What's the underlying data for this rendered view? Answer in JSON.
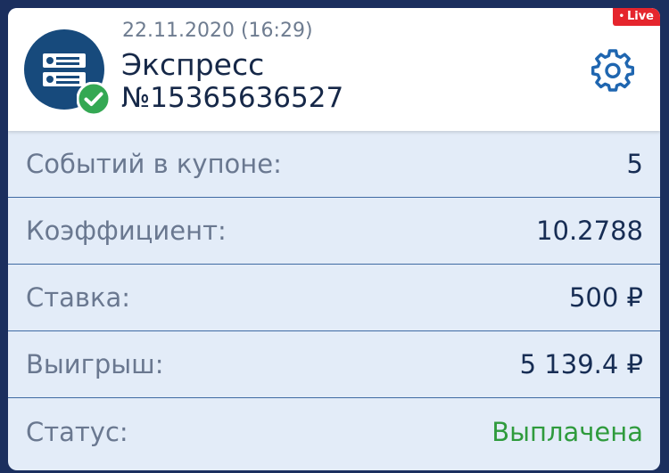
{
  "header": {
    "date": "22.11.2020 (16:29)",
    "bet_type": "Экспресс",
    "bet_number": "№15365636527",
    "live_badge": "Live"
  },
  "icons": {
    "coupon": "coupon-icon",
    "check": "check-circle-icon",
    "settings": "gear-icon"
  },
  "colors": {
    "accent_blue": "#1f66b0",
    "icon_dark_blue": "#174a7c",
    "status_green": "#2f9b3d",
    "live_red": "#e5252d",
    "background": "#1b2f5e"
  },
  "details": [
    {
      "label": "Событий в купоне:",
      "value": "5"
    },
    {
      "label": "Коэффициент:",
      "value": "10.2788"
    },
    {
      "label": "Ставка:",
      "value": "500 ₽"
    },
    {
      "label": "Выигрыш:",
      "value": "5 139.4 ₽"
    },
    {
      "label": "Статус:",
      "value": "Выплачена"
    }
  ]
}
